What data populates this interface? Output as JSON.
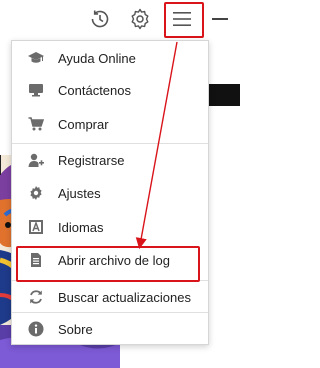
{
  "toolbar": {
    "history_icon": "history-clock-icon",
    "settings_icon": "gear-icon",
    "menu_icon": "hamburger-menu-icon",
    "minimize_icon": "minimize-icon"
  },
  "menu": {
    "items": [
      {
        "label": "Ayuda Online",
        "icon": "graduation-cap-icon"
      },
      {
        "label": "Contáctenos",
        "icon": "monitor-icon"
      },
      {
        "label": "Comprar",
        "icon": "shopping-cart-icon"
      },
      {
        "label": "Registrarse",
        "icon": "user-add-icon"
      },
      {
        "label": "Ajustes",
        "icon": "gear-icon"
      },
      {
        "label": "Idiomas",
        "icon": "language-icon"
      },
      {
        "label": "Abrir archivo de log",
        "icon": "document-icon"
      },
      {
        "label": "Buscar actualizaciones",
        "icon": "refresh-icon"
      },
      {
        "label": "Sobre",
        "icon": "info-icon"
      }
    ]
  },
  "annotation": {
    "highlight_color": "#d9141a"
  }
}
